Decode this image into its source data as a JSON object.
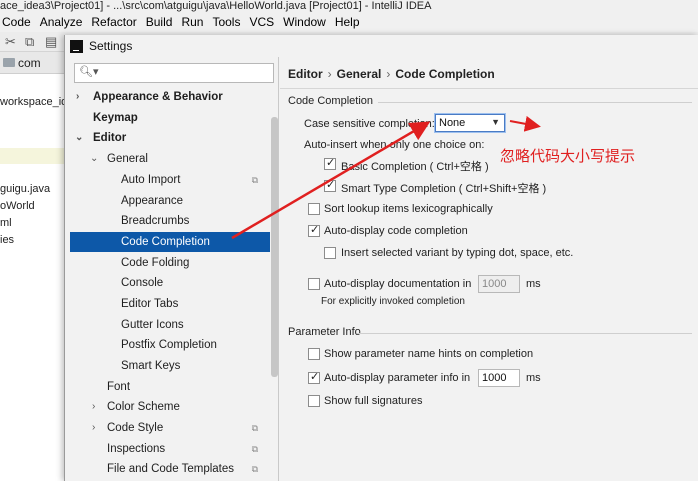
{
  "ide": {
    "title": "ace_idea3\\Project01] - ...\\src\\com\\atguigu\\java\\HelloWorld.java [Project01] - IntelliJ IDEA",
    "menu": [
      "Code",
      "Analyze",
      "Refactor",
      "Build",
      "Run",
      "Tools",
      "VCS",
      "Window",
      "Help"
    ],
    "nav_label": "com",
    "left_items": [
      "workspace_id",
      "guigu.java",
      "oWorld",
      "ml",
      "ies"
    ]
  },
  "dialog": {
    "title": "Settings",
    "search": {
      "value": "",
      "placeholder": ""
    },
    "tree": {
      "appearance": "Appearance & Behavior",
      "keymap": "Keymap",
      "editor": "Editor",
      "general": "General",
      "auto_import": "Auto Import",
      "appearance_item": "Appearance",
      "breadcrumbs": "Breadcrumbs",
      "code_completion": "Code Completion",
      "code_folding": "Code Folding",
      "console": "Console",
      "editor_tabs": "Editor Tabs",
      "gutter_icons": "Gutter Icons",
      "postfix": "Postfix Completion",
      "smart_keys": "Smart Keys",
      "font": "Font",
      "color_scheme": "Color Scheme",
      "code_style": "Code Style",
      "inspections": "Inspections",
      "file_templates": "File and Code Templates"
    },
    "breadcrumb": [
      "Editor",
      "General",
      "Code Completion"
    ],
    "code_completion": {
      "group": "Code Completion",
      "case_label": "Case sensitive completion:",
      "case_value": "None",
      "auto_insert_label": "Auto-insert when only one choice on:",
      "basic": "Basic Completion ( Ctrl+空格 )",
      "smart": "Smart Type Completion ( Ctrl+Shift+空格 )",
      "sort_lookup": "Sort lookup items lexicographically",
      "auto_display": "Auto-display code completion",
      "insert_variant": "Insert selected variant by typing dot, space, etc.",
      "auto_doc": "Auto-display documentation in",
      "auto_doc_value": "1000",
      "ms": "ms",
      "explicit_note": "For explicitly invoked completion"
    },
    "parameter_info": {
      "group": "Parameter Info",
      "show_hints": "Show parameter name hints on completion",
      "auto_param": "Auto-display parameter info in",
      "auto_param_value": "1000",
      "ms": "ms",
      "full_sig": "Show full signatures"
    },
    "checked": {
      "basic": true,
      "smart": true,
      "sort_lookup": false,
      "auto_display": true,
      "insert_variant": false,
      "auto_doc": false,
      "show_hints": false,
      "auto_param": true,
      "full_sig": false
    }
  },
  "annotation": {
    "text": "忽略代码大小写提示",
    "color": "#e02020"
  }
}
